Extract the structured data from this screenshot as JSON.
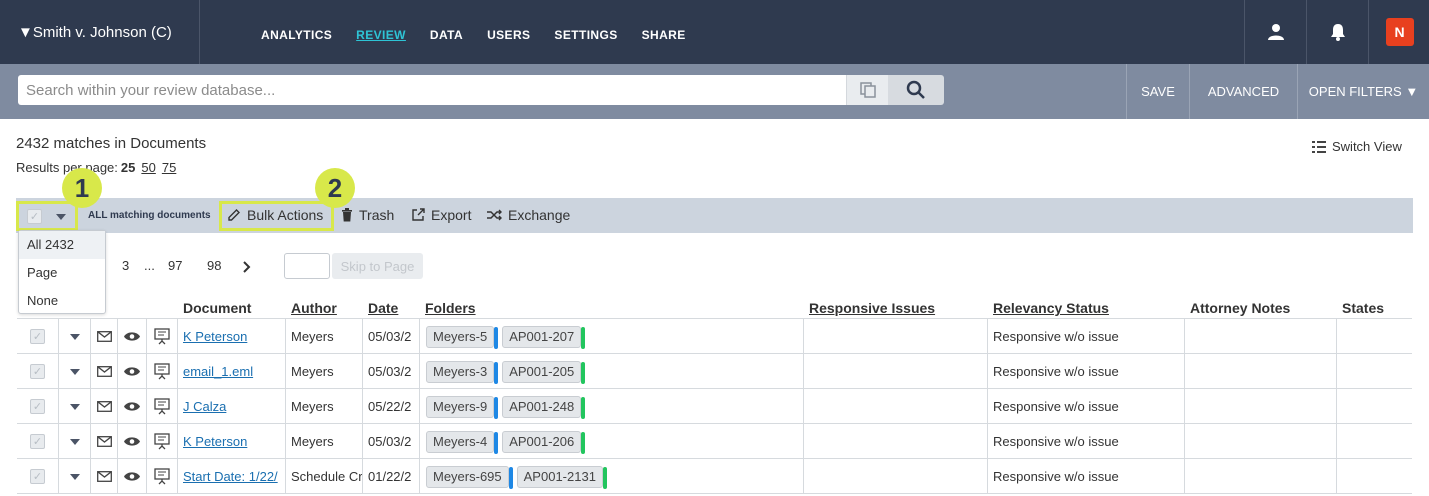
{
  "header": {
    "case_title": "▼Smith v. Johnson (C)",
    "nav": [
      "ANALYTICS",
      "REVIEW",
      "DATA",
      "USERS",
      "SETTINGS",
      "SHARE"
    ],
    "active_nav": "REVIEW",
    "brand_letter": "N"
  },
  "search": {
    "placeholder": "Search within your review database...",
    "save_label": "SAVE",
    "advanced_label": "ADVANCED",
    "open_filters_label": "OPEN FILTERS ▼"
  },
  "results": {
    "matches_text": "2432 matches in Documents",
    "per_page_label": "Results per page:",
    "per_page_options": [
      "25",
      "50",
      "75"
    ],
    "switch_view_label": "Switch View"
  },
  "actions": {
    "all_matching_label": "ALL matching documents",
    "bulk_actions_label": "Bulk Actions",
    "trash_label": "Trash",
    "export_label": "Export",
    "exchange_label": "Exchange",
    "callout_1": "1",
    "callout_2": "2"
  },
  "select_dropdown": {
    "options": [
      "All 2432",
      "Page",
      "None"
    ]
  },
  "pagination": {
    "pages": [
      "3",
      "...",
      "97",
      "98"
    ],
    "skip_label": "Skip to Page"
  },
  "table": {
    "columns": {
      "document": "Document",
      "author": "Author",
      "date": "Date",
      "folders": "Folders",
      "responsive_issues": "Responsive Issues",
      "relevancy_status": "Relevancy Status",
      "attorney_notes": "Attorney Notes",
      "states": "States"
    },
    "rows": [
      {
        "document": "K Peterson",
        "author": "Meyers",
        "date": "05/03/2",
        "folder1": "Meyers-5",
        "folder2": "AP001-207",
        "relevancy": "Responsive w/o issue"
      },
      {
        "document": "email_1.eml",
        "author": "Meyers",
        "date": "05/03/2",
        "folder1": "Meyers-3",
        "folder2": "AP001-205",
        "relevancy": "Responsive w/o issue"
      },
      {
        "document": "J Calza",
        "author": "Meyers",
        "date": "05/22/2",
        "folder1": "Meyers-9",
        "folder2": "AP001-248",
        "relevancy": "Responsive w/o issue"
      },
      {
        "document": "K Peterson",
        "author": "Meyers",
        "date": "05/03/2",
        "folder1": "Meyers-4",
        "folder2": "AP001-206",
        "relevancy": "Responsive w/o issue"
      },
      {
        "document": "Start Date: 1/22/",
        "author": "Schedule Cr",
        "date": "01/22/2",
        "folder1": "Meyers-695",
        "folder2": "AP001-2131",
        "relevancy": "Responsive w/o issue"
      }
    ]
  },
  "colors": {
    "nav_bg": "#2f3a4f",
    "searchbar_bg": "#7f8ba0",
    "accent": "#2ec4d6",
    "highlight": "#d8e84a",
    "folder_blue": "#1e88e5",
    "folder_green": "#22c55e",
    "brand": "#e8401f"
  }
}
